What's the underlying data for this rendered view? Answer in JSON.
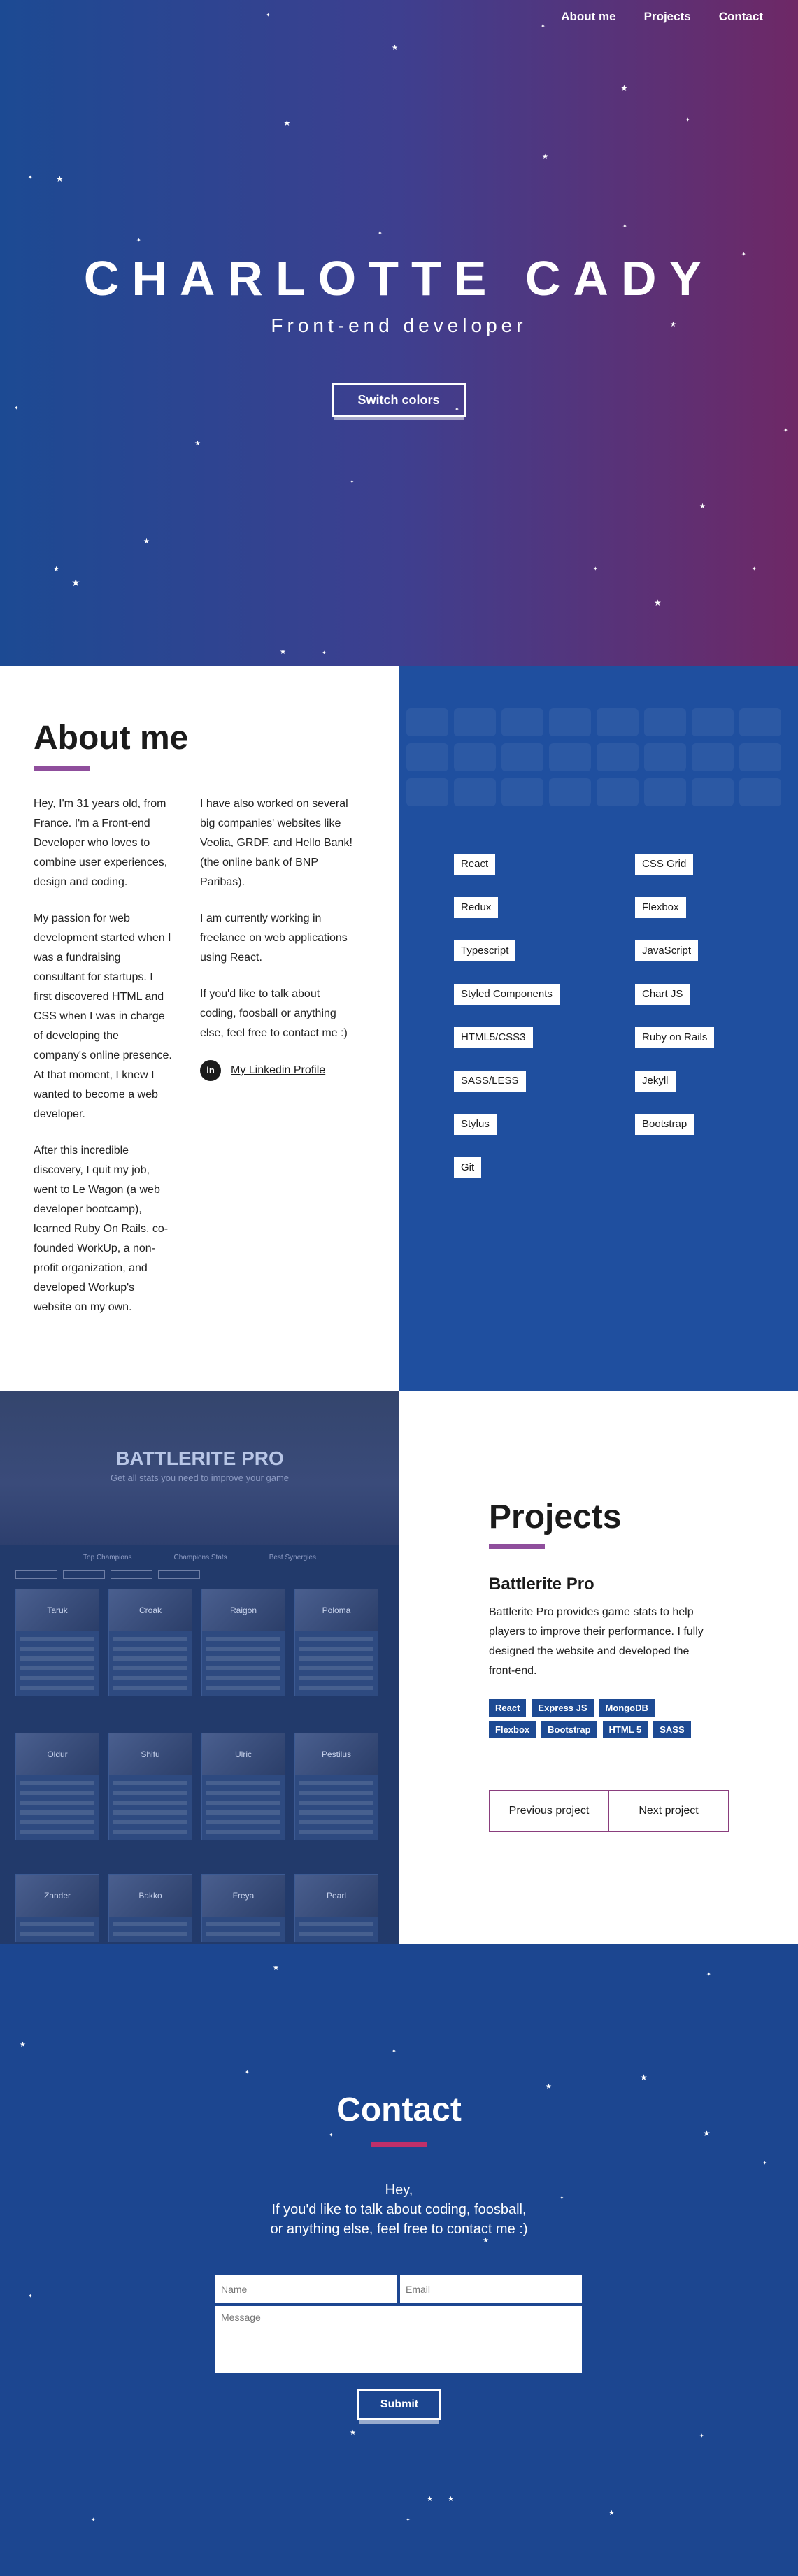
{
  "nav": {
    "items": [
      "About me",
      "Projects",
      "Contact"
    ]
  },
  "hero": {
    "title": "CHARLOTTE CADY",
    "subtitle": "Front-end developer",
    "button": "Switch colors"
  },
  "about": {
    "heading": "About me",
    "col1": [
      "Hey, I'm 31 years old, from France. I'm a Front-end Developer who loves to combine user experiences, design and coding.",
      "My passion for web development started when I was a fundraising consultant for startups. I first discovered HTML and CSS when I was in charge of developing the company's online presence. At that moment, I knew I wanted to become a web developer.",
      "After this incredible discovery, I quit my job, went to Le Wagon (a web developer bootcamp), learned Ruby On Rails, co-founded WorkUp, a non-profit organization, and developed Workup's website on my own."
    ],
    "col2": [
      "I have also worked on several big companies' websites like Veolia, GRDF, and Hello Bank! (the online bank of BNP Paribas).",
      "I am currently working in freelance on web applications using React.",
      "If you'd like to talk about coding, foosball or anything else, feel free to contact me :)"
    ],
    "linkedin_icon": "in",
    "linkedin": "My Linkedin Profile"
  },
  "skills": {
    "left": [
      "React",
      "Redux",
      "Typescript",
      "Styled Components",
      "HTML5/CSS3",
      "SASS/LESS",
      "Stylus",
      "Git"
    ],
    "right": [
      "CSS Grid",
      "Flexbox",
      "JavaScript",
      "Chart JS",
      "Ruby on Rails",
      "Jekyll",
      "Bootstrap"
    ]
  },
  "project_image": {
    "title": "BATTLERITE PRO",
    "subtitle": "Get all stats you need to improve your game",
    "nav": [
      "Top Champions",
      "Champions Stats",
      "Best Synergies"
    ],
    "cards": [
      "Taruk",
      "Croak",
      "Raigon",
      "Poloma",
      "Oldur",
      "Shifu",
      "Ulric",
      "Pestilus",
      "Zander",
      "Bakko",
      "Freya",
      "Pearl"
    ]
  },
  "projects": {
    "heading": "Projects",
    "name": "Battlerite Pro",
    "description": "Battlerite Pro provides game stats to help players to improve their performance. I fully designed the website and developed the front-end.",
    "tags": [
      "React",
      "Express JS",
      "MongoDB",
      "Flexbox",
      "Bootstrap",
      "HTML 5",
      "SASS"
    ],
    "prev": "Previous project",
    "next": "Next project"
  },
  "contact": {
    "heading": "Contact",
    "line1": "Hey,",
    "line2": "If you'd like to talk about coding, foosball,",
    "line3": "or anything else, feel free to contact me :)",
    "name_placeholder": "Name",
    "email_placeholder": "Email",
    "message_placeholder": "Message",
    "submit": "Submit"
  },
  "colors": {
    "hero_left": "#1c4a93",
    "hero_right": "#6e2866",
    "accent": "#8f4e9c",
    "tag_blue": "#1d4a93",
    "contact_bg": "#1c4690"
  }
}
